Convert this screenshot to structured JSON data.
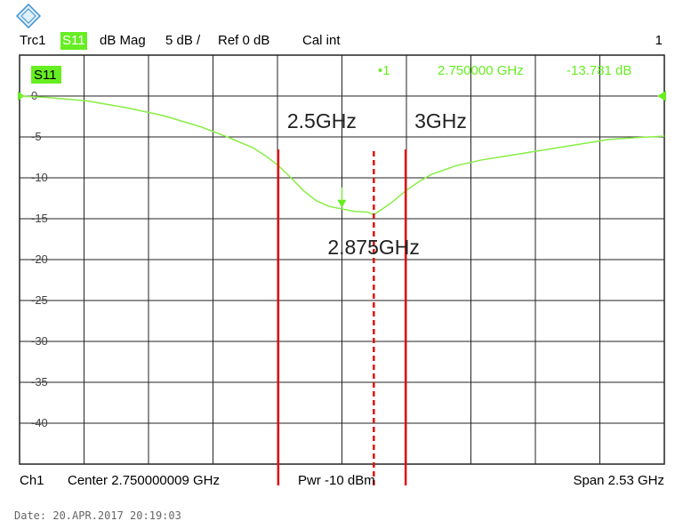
{
  "header": {
    "trace": "Trc1",
    "param": "S11",
    "format": "dB Mag",
    "scale": "5 dB /",
    "ref": "Ref 0 dB",
    "cal": "Cal int",
    "channel_no": "1"
  },
  "footer": {
    "channel": "Ch1",
    "center": "Center  2.750000009 GHz",
    "power": "Pwr  -10 dBm",
    "span": "Span  2.53 GHz"
  },
  "date": "Date: 20.APR.2017  20:19:03",
  "colors": {
    "trace": "#88ee44",
    "marker": "#66ee22",
    "annotation_line": "#dd1111",
    "grid": "#222222"
  },
  "chart_data": {
    "type": "line",
    "title": "",
    "xlabel": "",
    "ylabel": "",
    "x_unit": "GHz",
    "xlim": [
      1.485,
      4.015
    ],
    "ylim": [
      -45,
      5
    ],
    "yticks": [
      {
        "value": 0,
        "label": "0"
      },
      {
        "value": -5,
        "label": "-5"
      },
      {
        "value": -10,
        "label": "-10"
      },
      {
        "value": -15,
        "label": "-15"
      },
      {
        "value": -20,
        "label": "-20"
      },
      {
        "value": -25,
        "label": "-25"
      },
      {
        "value": -30,
        "label": "-30"
      },
      {
        "value": -35,
        "label": "-35"
      },
      {
        "value": -40,
        "label": "-40"
      }
    ],
    "x": [
      1.485,
      1.6,
      1.75,
      1.9,
      2.05,
      2.2,
      2.3,
      2.4,
      2.45,
      2.5,
      2.55,
      2.6,
      2.65,
      2.7,
      2.75,
      2.8,
      2.85,
      2.875,
      2.9,
      2.95,
      3.0,
      3.05,
      3.1,
      3.2,
      3.3,
      3.4,
      3.5,
      3.6,
      3.7,
      3.8,
      3.9,
      4.015
    ],
    "series": [
      {
        "values": [
          0.0,
          -0.2,
          -0.6,
          -1.4,
          -2.4,
          -3.8,
          -5.0,
          -6.3,
          -7.3,
          -8.5,
          -10.0,
          -11.6,
          -12.8,
          -13.5,
          -13.8,
          -14.1,
          -14.2,
          -14.5,
          -14.0,
          -12.9,
          -11.6,
          -10.5,
          -9.6,
          -8.5,
          -7.8,
          -7.3,
          -6.8,
          -6.3,
          -5.8,
          -5.3,
          -5.1,
          -4.9
        ]
      }
    ],
    "marker": {
      "label": "1",
      "legend_label": "•1",
      "x": 2.75,
      "y": -13.781,
      "readout_freq": "2.750000  GHz",
      "readout_value": "-13.781  dB"
    },
    "param_label": "S11",
    "vlines": [
      {
        "x": 2.5,
        "style": "solid",
        "label": "2.5GHz"
      },
      {
        "x": 3.0,
        "style": "solid",
        "label": "3GHz"
      },
      {
        "x": 2.875,
        "style": "dashed",
        "label": "2.875GHz"
      }
    ]
  }
}
